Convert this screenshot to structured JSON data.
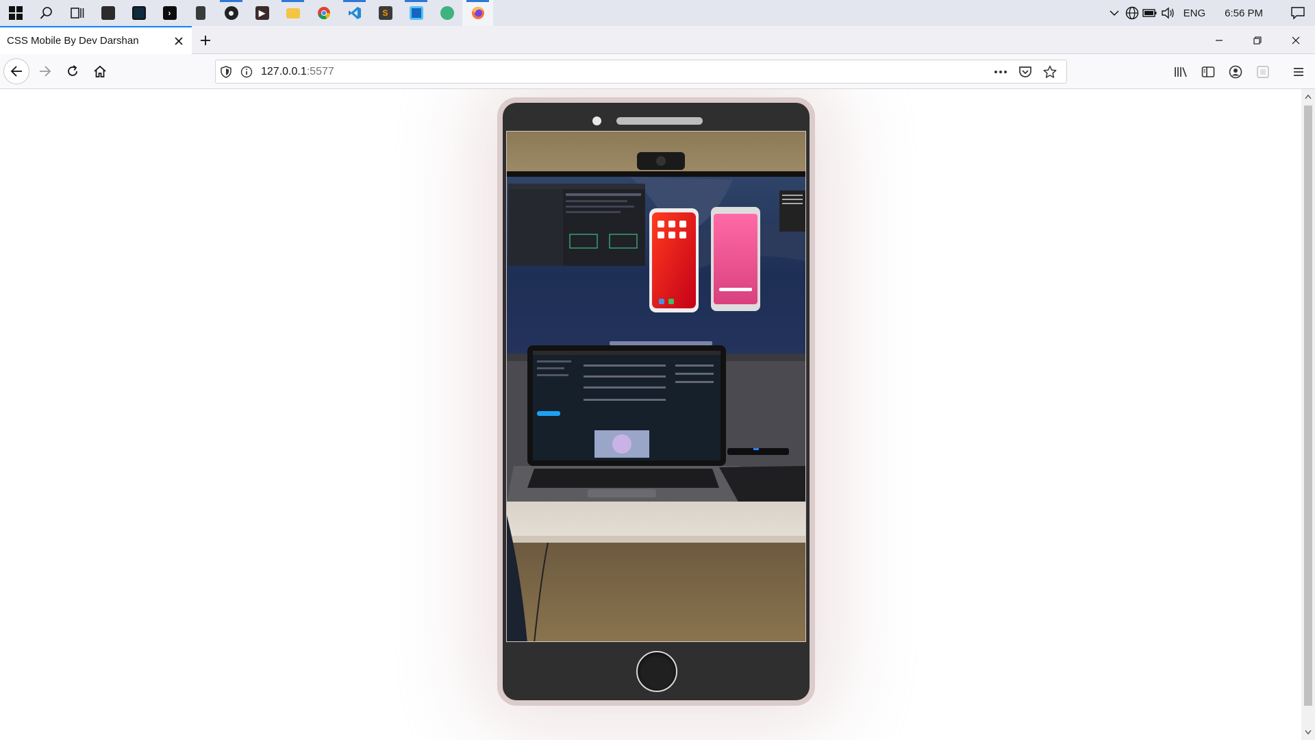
{
  "taskbar": {
    "apps": [
      {
        "icon": "start-windows-icon"
      },
      {
        "icon": "search-icon"
      },
      {
        "icon": "task-view-icon"
      },
      {
        "icon": "app-icon"
      },
      {
        "icon": "terminal-icon"
      },
      {
        "icon": "command-prompt-icon"
      },
      {
        "icon": "calculator-icon"
      },
      {
        "icon": "media-player-icon"
      },
      {
        "icon": "video-player-icon"
      },
      {
        "icon": "file-explorer-icon"
      },
      {
        "icon": "chrome-icon"
      },
      {
        "icon": "vscode-icon"
      },
      {
        "icon": "sublime-text-icon"
      },
      {
        "icon": "editor-icon"
      },
      {
        "icon": "chatgpt-icon"
      },
      {
        "icon": "firefox-icon"
      }
    ],
    "tray": {
      "language": "ENG",
      "time": "6:56 PM"
    }
  },
  "browser": {
    "tab_title": "CSS Mobile By Dev Darshan",
    "url_host": "127.0.0.1",
    "url_port": ":5577"
  },
  "page": {
    "screen_image": "desk-setup-photo"
  },
  "colors": {
    "phone_frame": "#dbcbcb",
    "phone_body": "#2f2f2f",
    "accent": "#0a84ff"
  }
}
